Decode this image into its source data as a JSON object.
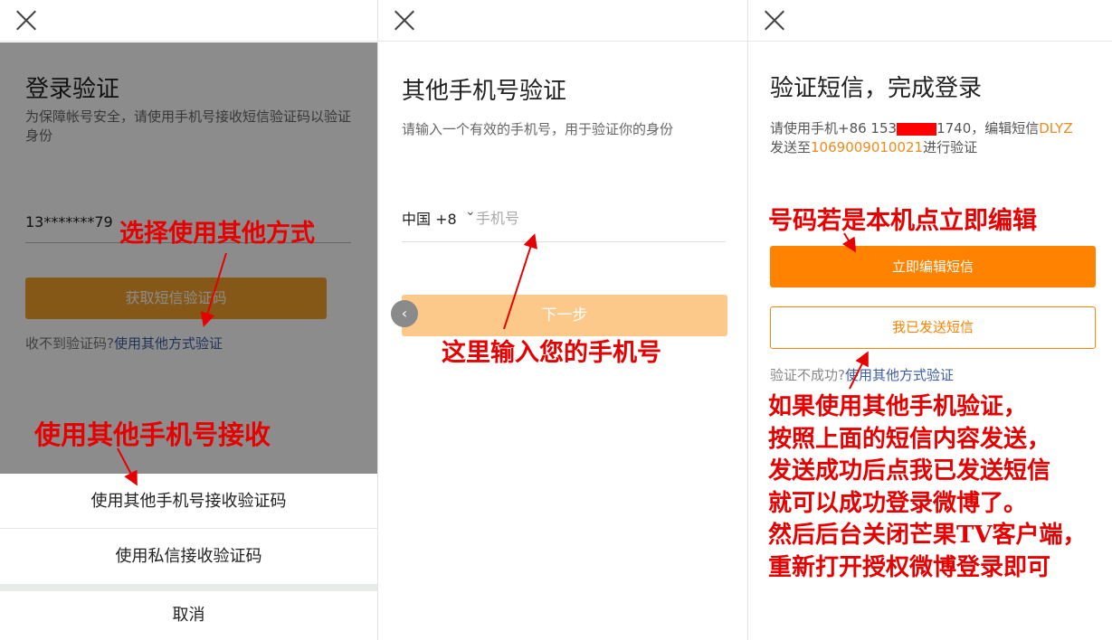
{
  "panel1": {
    "title": "登录验证",
    "subtitle": "为保障帐号安全，请使用手机号接收短信验证码以验证身份",
    "masked_phone": "13*******79",
    "get_code_button": "获取短信验证码",
    "no_code_text": "收不到验证码?",
    "other_method_link": "使用其他方式验证",
    "sheet": {
      "option_other_phone": "使用其他手机号接收验证码",
      "option_private_msg": "使用私信接收验证码",
      "cancel": "取消"
    },
    "annotations": {
      "choose_other": "选择使用其他方式",
      "use_other_phone": "使用其他手机号接收"
    }
  },
  "panel2": {
    "title": "其他手机号验证",
    "subtitle": "请输入一个有效的手机号，用于验证你的身份",
    "country": "中国 +8",
    "phone_placeholder": "手机号",
    "next_button": "下一步",
    "back_icon_glyph": "‹",
    "annotations": {
      "enter_phone": "这里输入您的手机号"
    }
  },
  "panel3": {
    "title": "验证短信，完成登录",
    "instr_prefix": "请使用手机+86 153",
    "instr_suffix": "1740，编辑短信",
    "sms_code": "DLYZ",
    "send_to_prefix": "发送至",
    "send_number": "1069009010021",
    "send_to_suffix": "进行验证",
    "edit_sms_button": "立即编辑短信",
    "sent_sms_button": "我已发送短信",
    "fail_text": "验证不成功?",
    "other_method_link": "使用其他方式验证",
    "annotations": {
      "if_local": "号码若是本机点立即编辑",
      "line1": "如果使用其他手机验证，",
      "line2": "按照上面的短信内容发送，",
      "line3": "发送成功后点我已发送短信",
      "line4": "就可以成功登录微博了。",
      "line5": "然后后台关闭芒果TV客户端，",
      "line6": "重新打开授权微博登录即可"
    }
  },
  "colors": {
    "accent_orange": "#ff8200",
    "link_blue": "#3b5da3",
    "annotation_red": "#e60000"
  }
}
